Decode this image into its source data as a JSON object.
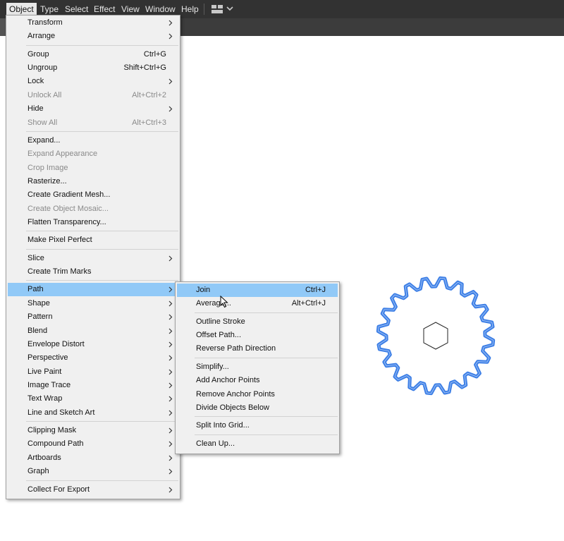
{
  "menubar": {
    "items": [
      "Object",
      "Type",
      "Select",
      "Effect",
      "View",
      "Window",
      "Help"
    ],
    "active": "Object",
    "layout_icon": "workspace-layout-icon",
    "layout_chevron": "chevron-down-icon"
  },
  "object_menu": {
    "items": [
      {
        "label": "Transform",
        "submenu": true
      },
      {
        "label": "Arrange",
        "submenu": true
      },
      {
        "divider": true
      },
      {
        "label": "Group",
        "shortcut": "Ctrl+G"
      },
      {
        "label": "Ungroup",
        "shortcut": "Shift+Ctrl+G"
      },
      {
        "label": "Lock",
        "submenu": true
      },
      {
        "label": "Unlock All",
        "shortcut": "Alt+Ctrl+2",
        "disabled": true
      },
      {
        "label": "Hide",
        "submenu": true
      },
      {
        "label": "Show All",
        "shortcut": "Alt+Ctrl+3",
        "disabled": true
      },
      {
        "divider": true
      },
      {
        "label": "Expand..."
      },
      {
        "label": "Expand Appearance",
        "disabled": true
      },
      {
        "label": "Crop Image",
        "disabled": true
      },
      {
        "label": "Rasterize..."
      },
      {
        "label": "Create Gradient Mesh..."
      },
      {
        "label": "Create Object Mosaic...",
        "disabled": true
      },
      {
        "label": "Flatten Transparency..."
      },
      {
        "divider": true
      },
      {
        "label": "Make Pixel Perfect"
      },
      {
        "divider": true
      },
      {
        "label": "Slice",
        "submenu": true
      },
      {
        "label": "Create Trim Marks"
      },
      {
        "divider": true
      },
      {
        "label": "Path",
        "submenu": true,
        "highlighted": true
      },
      {
        "label": "Shape",
        "submenu": true
      },
      {
        "label": "Pattern",
        "submenu": true
      },
      {
        "label": "Blend",
        "submenu": true
      },
      {
        "label": "Envelope Distort",
        "submenu": true
      },
      {
        "label": "Perspective",
        "submenu": true
      },
      {
        "label": "Live Paint",
        "submenu": true
      },
      {
        "label": "Image Trace",
        "submenu": true
      },
      {
        "label": "Text Wrap",
        "submenu": true
      },
      {
        "label": "Line and Sketch Art",
        "submenu": true
      },
      {
        "divider": true
      },
      {
        "label": "Clipping Mask",
        "submenu": true
      },
      {
        "label": "Compound Path",
        "submenu": true
      },
      {
        "label": "Artboards",
        "submenu": true
      },
      {
        "label": "Graph",
        "submenu": true
      },
      {
        "divider": true
      },
      {
        "label": "Collect For Export",
        "submenu": true
      }
    ]
  },
  "path_menu": {
    "items": [
      {
        "label": "Join",
        "shortcut": "Ctrl+J",
        "highlighted": true
      },
      {
        "label": "Average...",
        "shortcut": "Alt+Ctrl+J"
      },
      {
        "divider": true
      },
      {
        "label": "Outline Stroke"
      },
      {
        "label": "Offset Path..."
      },
      {
        "label": "Reverse Path Direction"
      },
      {
        "divider": true
      },
      {
        "label": "Simplify..."
      },
      {
        "label": "Add Anchor Points"
      },
      {
        "label": "Remove Anchor Points"
      },
      {
        "label": "Divide Objects Below"
      },
      {
        "divider": true
      },
      {
        "label": "Split Into Grid..."
      },
      {
        "divider": true
      },
      {
        "label": "Clean Up..."
      }
    ]
  },
  "canvas": {
    "gear": {
      "teeth": 20,
      "stroke_color": "#3d7fe6",
      "selected": true
    },
    "hexagon": {
      "stroke_color": "#222222"
    }
  },
  "colors": {
    "highlight": "#91c9f7",
    "menubar": "#323232",
    "menu_bg": "#f0f0f0"
  },
  "cursor_icon": "arrow-cursor-icon"
}
